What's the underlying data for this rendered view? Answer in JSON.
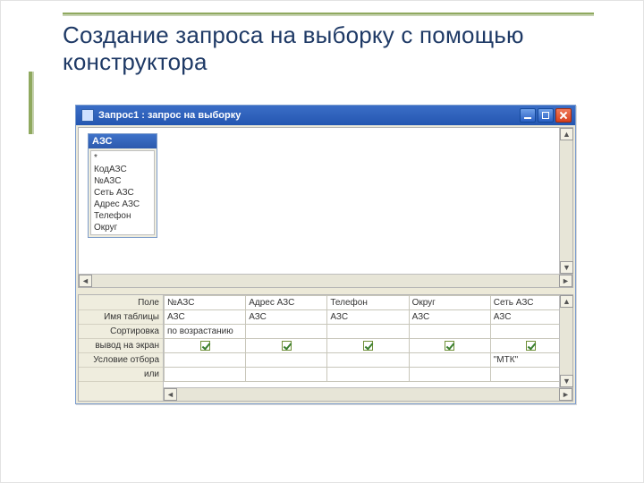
{
  "slide": {
    "title": "Создание запроса на выборку с помощью конструктора"
  },
  "window": {
    "title": "Запрос1 : запрос на выборку",
    "table": {
      "name": "АЗС",
      "fields": [
        "*",
        "КодАЗС",
        "№АЗС",
        "Сеть АЗС",
        "Адрес АЗС",
        "Телефон",
        "Округ"
      ]
    },
    "grid": {
      "rowLabels": [
        "Поле",
        "Имя таблицы",
        "Сортировка",
        "вывод на экран",
        "Условие отбора",
        "или"
      ],
      "columns": [
        {
          "field": "№АЗС",
          "table": "АЗС",
          "sort": "по возрастанию",
          "show": true,
          "criteria": "",
          "or": ""
        },
        {
          "field": "Адрес АЗС",
          "table": "АЗС",
          "sort": "",
          "show": true,
          "criteria": "",
          "or": ""
        },
        {
          "field": "Телефон",
          "table": "АЗС",
          "sort": "",
          "show": true,
          "criteria": "",
          "or": ""
        },
        {
          "field": "Округ",
          "table": "АЗС",
          "sort": "",
          "show": true,
          "criteria": "",
          "or": ""
        },
        {
          "field": "Сеть АЗС",
          "table": "АЗС",
          "sort": "",
          "show": true,
          "criteria": "\"МТК\"",
          "or": ""
        }
      ]
    }
  }
}
